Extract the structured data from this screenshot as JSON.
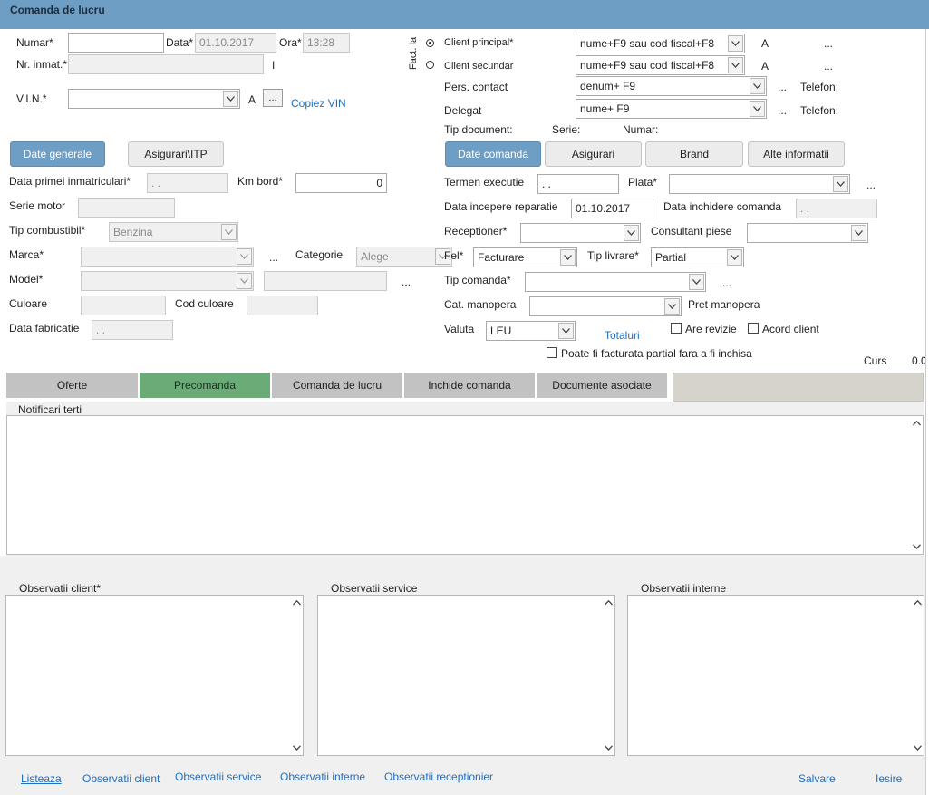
{
  "title": "Comanda de lucru",
  "left": {
    "numar_label": "Numar*",
    "numar_value": "",
    "data_label": "Data*",
    "data_value": "01.10.2017",
    "ora_label": "Ora*",
    "ora_value": "13:28",
    "nr_inmat_label": "Nr. inmat.*",
    "nr_inmat_value": "",
    "nr_inmat_suffix": "I",
    "vin_label": "V.I.N.*",
    "vin_value": "",
    "vin_a": "A",
    "vin_dots": "...",
    "copiez_vin": "Copiez VIN"
  },
  "client": {
    "fact_la": "Fact. la",
    "principal_label": "Client principal*",
    "principal_value": "nume+F9 sau cod fiscal+F8",
    "principal_a": "A",
    "principal_dots": "...",
    "secundar_label": "Client secundar",
    "secundar_value": "nume+F9 sau cod fiscal+F8",
    "secundar_a": "A",
    "secundar_dots": "...",
    "pers_label": "Pers. contact",
    "pers_value": "denum+ F9",
    "pers_dots": "...",
    "pers_tel": "Telefon:",
    "delegat_label": "Delegat",
    "delegat_value": "nume+ F9",
    "delegat_dots": "...",
    "delegat_tel": "Telefon:",
    "tip_doc": "Tip document:",
    "serie": "Serie:",
    "numar": "Numar:"
  },
  "left_tabs": [
    "Date generale",
    "Asigurari\\ITP"
  ],
  "right_tabs": [
    "Date comanda",
    "Asigurari",
    "Brand",
    "Alte informatii"
  ],
  "general": {
    "data_prim_label": "Data primei inmatriculari*",
    "data_prim_value": " .  .",
    "km_label": "Km bord*",
    "km_value": "0",
    "serie_motor_label": "Serie motor",
    "tip_comb_label": "Tip combustibil*",
    "tip_comb_value": "Benzina",
    "marca_label": "Marca*",
    "marca_dots": "...",
    "categorie_label": "Categorie",
    "categorie_value": "Alege",
    "model_label": "Model*",
    "model_dots": "...",
    "culoare_label": "Culoare",
    "cod_culoare_label": "Cod culoare",
    "data_fab_label": "Data fabricatie",
    "data_fab_value": " .  ."
  },
  "comanda": {
    "termen_label": "Termen executie",
    "termen_value": " .  .",
    "plata_label": "Plata*",
    "plata_dots": "...",
    "data_inc_label": "Data incepere reparatie",
    "data_inc_value": "01.10.2017",
    "data_inch_label": "Data inchidere comanda",
    "data_inch_value": " .  .",
    "receptioner_label": "Receptioner*",
    "consultant_label": "Consultant piese",
    "fel_label": "Fel*",
    "fel_value": "Facturare",
    "tip_livrare_label": "Tip livrare*",
    "tip_livrare_value": "Partial",
    "tip_comanda_label": "Tip comanda*",
    "tip_comanda_dots": "...",
    "cat_manopera_label": "Cat. manopera",
    "pret_manopera_label": "Pret manopera",
    "valuta_label": "Valuta",
    "valuta_value": "LEU",
    "totaluri": "Totaluri",
    "are_revizie": "Are revizie",
    "acord_client": "Acord client",
    "poate_fi": "Poate fi facturata partial fara a fi inchisa",
    "curs_label": "Curs",
    "curs_value": "0.0"
  },
  "main_tabs": [
    "Oferte",
    "Precomanda",
    "Comanda de lucru",
    "Inchide comanda",
    "Documente asociate"
  ],
  "notificari_label": "Notificari terti",
  "obs_client_label": "Observatii client*",
  "obs_service_label": "Observatii service",
  "obs_interne_label": "Observatii interne",
  "footer": {
    "listeaza": "Listeaza",
    "obs_client": "Observatii client",
    "obs_service": "Observatii service",
    "obs_interne": "Observatii interne",
    "obs_receptionier": "Observatii receptionier",
    "salvare": "Salvare",
    "iesire": "Iesire"
  },
  "colors": {
    "accent": "#6f9ec4",
    "active_tab": "#6aab78",
    "tab": "#c2c2c2",
    "link": "#1f6fbf"
  }
}
